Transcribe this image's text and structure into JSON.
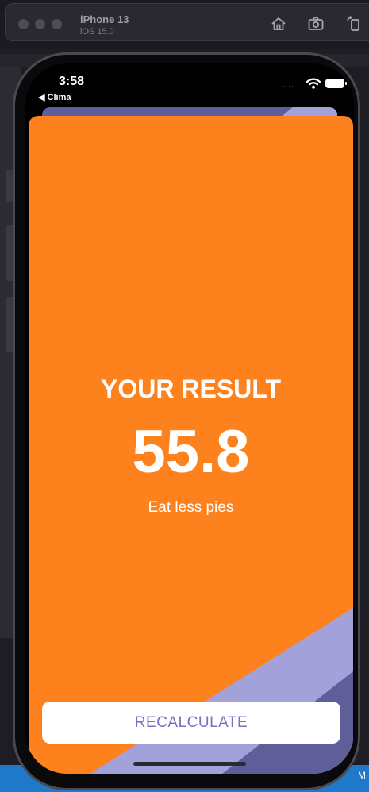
{
  "simulator": {
    "device_name": "iPhone 13",
    "os_version": "iOS 15.0",
    "icons": [
      "home-icon",
      "screenshot-icon",
      "rotate-icon"
    ]
  },
  "status_bar": {
    "time": "3:58",
    "back_label": "◀ Clima",
    "signal_text": "····",
    "icons": [
      "wifi-icon",
      "battery-icon"
    ]
  },
  "result": {
    "title": "YOUR RESULT",
    "value": "55.8",
    "advice": "Eat less pies",
    "background_color": "#fd821d"
  },
  "recalculate_button": {
    "label": "RECALCULATE",
    "text_color": "#7371c4"
  },
  "footer": {
    "edge_text": "M"
  },
  "colors": {
    "accent_purple_light": "#a3a1da",
    "accent_purple_dark": "#5f5d9a"
  }
}
